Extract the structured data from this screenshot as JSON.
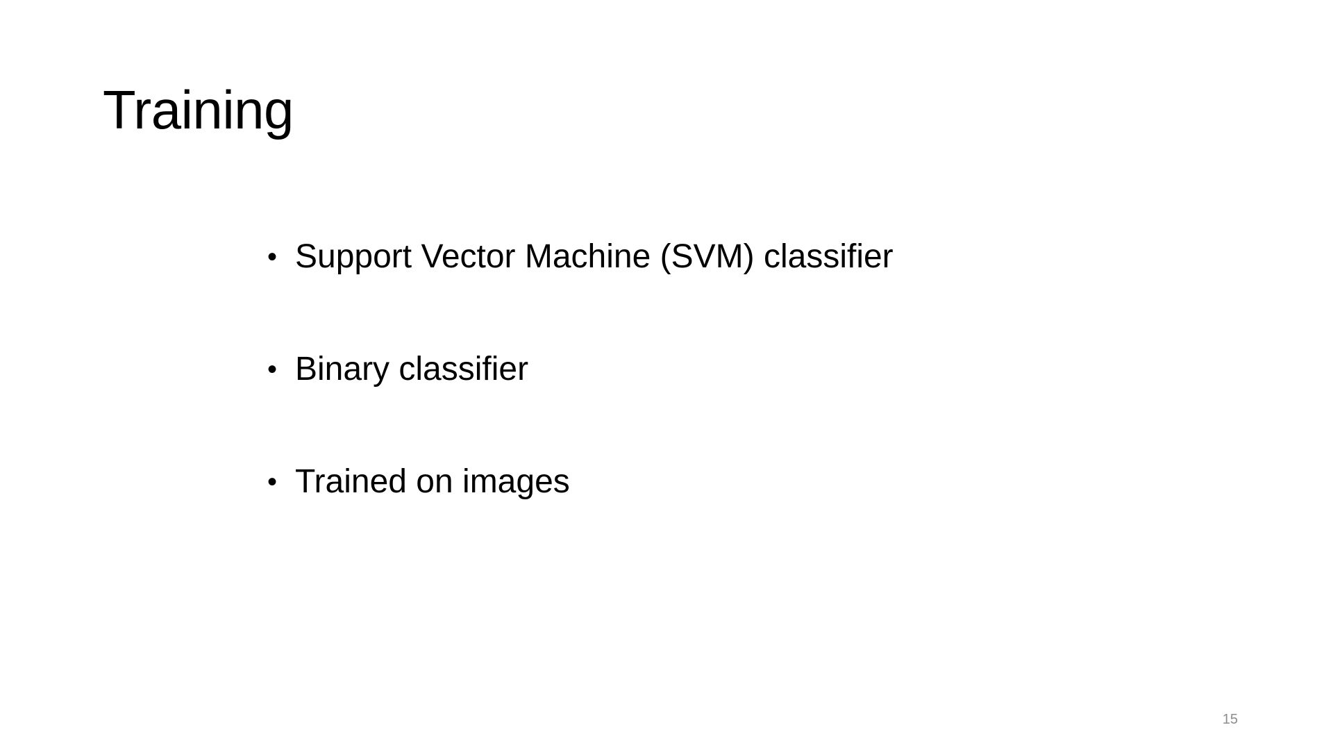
{
  "slide": {
    "title": "Training",
    "bullets": [
      {
        "marker": "•",
        "text": "Support Vector Machine (SVM) classifier"
      },
      {
        "marker": "•",
        "text": "Binary classifier"
      },
      {
        "marker": "•",
        "text": "Trained on images"
      }
    ],
    "page_number": "15"
  }
}
